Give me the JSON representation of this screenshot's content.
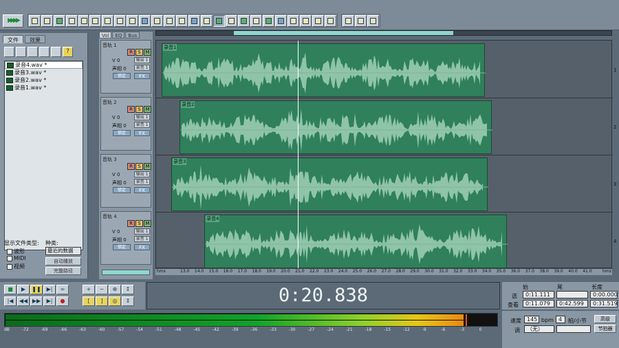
{
  "panel": {
    "tab_files": "文件",
    "tab_effects": "效果",
    "help_glyph": "?",
    "files": [
      "录音4.wav *",
      "录音3.wav *",
      "录音2.wav *",
      "录音1.wav *"
    ],
    "show_types_label": "显示文件类型:",
    "sort_label": "种类:",
    "types": [
      "波形",
      "MIDI",
      "视频"
    ],
    "sort_value": "最近的数据",
    "auto_play_label": "自动播放",
    "full_path_label": "完整路径"
  },
  "track_tabs": [
    "Vol",
    "EQ",
    "Bus"
  ],
  "tracks": [
    {
      "name": "音轨 1",
      "clip": "录音1",
      "vol": "V 0",
      "pan": "声相 0",
      "out": "输出 1",
      "rec": "录音 1",
      "lock": "锁定",
      "fx": "FX",
      "r": "R",
      "s": "S",
      "m": "M",
      "num": "1"
    },
    {
      "name": "音轨 2",
      "clip": "录音2",
      "vol": "V 0",
      "pan": "声相 0",
      "out": "输出 1",
      "rec": "录音 1",
      "lock": "锁定",
      "fx": "FX",
      "r": "R",
      "s": "S",
      "m": "M",
      "num": "2"
    },
    {
      "name": "音轨 3",
      "clip": "录音3",
      "vol": "V 0",
      "pan": "声相 0",
      "out": "输出 1",
      "rec": "录音 1",
      "lock": "锁定",
      "fx": "FX",
      "r": "R",
      "s": "S",
      "m": "M",
      "num": "3"
    },
    {
      "name": "音轨 4",
      "clip": "录音4",
      "vol": "V 0",
      "pan": "声相 0",
      "out": "输出 1",
      "rec": "录音 1",
      "lock": "锁定",
      "fx": "FX",
      "r": "R",
      "s": "S",
      "m": "M",
      "num": "4"
    }
  ],
  "ruler": [
    "hms",
    "13.0",
    "14.0",
    "15.0",
    "16.0",
    "17.0",
    "18.0",
    "19.0",
    "20.0",
    "21.0",
    "22.0",
    "23.0",
    "24.0",
    "25.0",
    "26.0",
    "27.0",
    "28.0",
    "29.0",
    "30.0",
    "31.0",
    "32.0",
    "33.0",
    "34.0",
    "35.0",
    "36.0",
    "37.0",
    "38.0",
    "39.0",
    "40.0",
    "41.0",
    "hms"
  ],
  "time_display": "0:20.838",
  "selection": {
    "h_start": "始",
    "h_end": "尾",
    "h_length": "长度",
    "sel_label": "选",
    "view_label": "查看",
    "sel_start": "0:11.111",
    "sel_end": "",
    "sel_length": "0:00.000",
    "view_start": "0:11.079",
    "view_end": "0:42.599",
    "view_length": "0:31.519"
  },
  "meter_scale": [
    "dB",
    "-72",
    "-69",
    "-66",
    "-63",
    "-60",
    "-57",
    "-54",
    "-51",
    "-48",
    "-45",
    "-42",
    "-39",
    "-36",
    "-33",
    "-30",
    "-27",
    "-24",
    "-21",
    "-18",
    "-15",
    "-12",
    "-9",
    "-6",
    "-3",
    "0"
  ],
  "meter_level": 0.93,
  "tempo": {
    "speed_label": "速度",
    "bpm": "145",
    "bpm_unit": "bpm",
    "beats": "4",
    "beats_unit": "拍/小节",
    "key_label": "调",
    "key_value": "（无）",
    "advanced_label": "高级",
    "metronome_label": "节拍器"
  }
}
